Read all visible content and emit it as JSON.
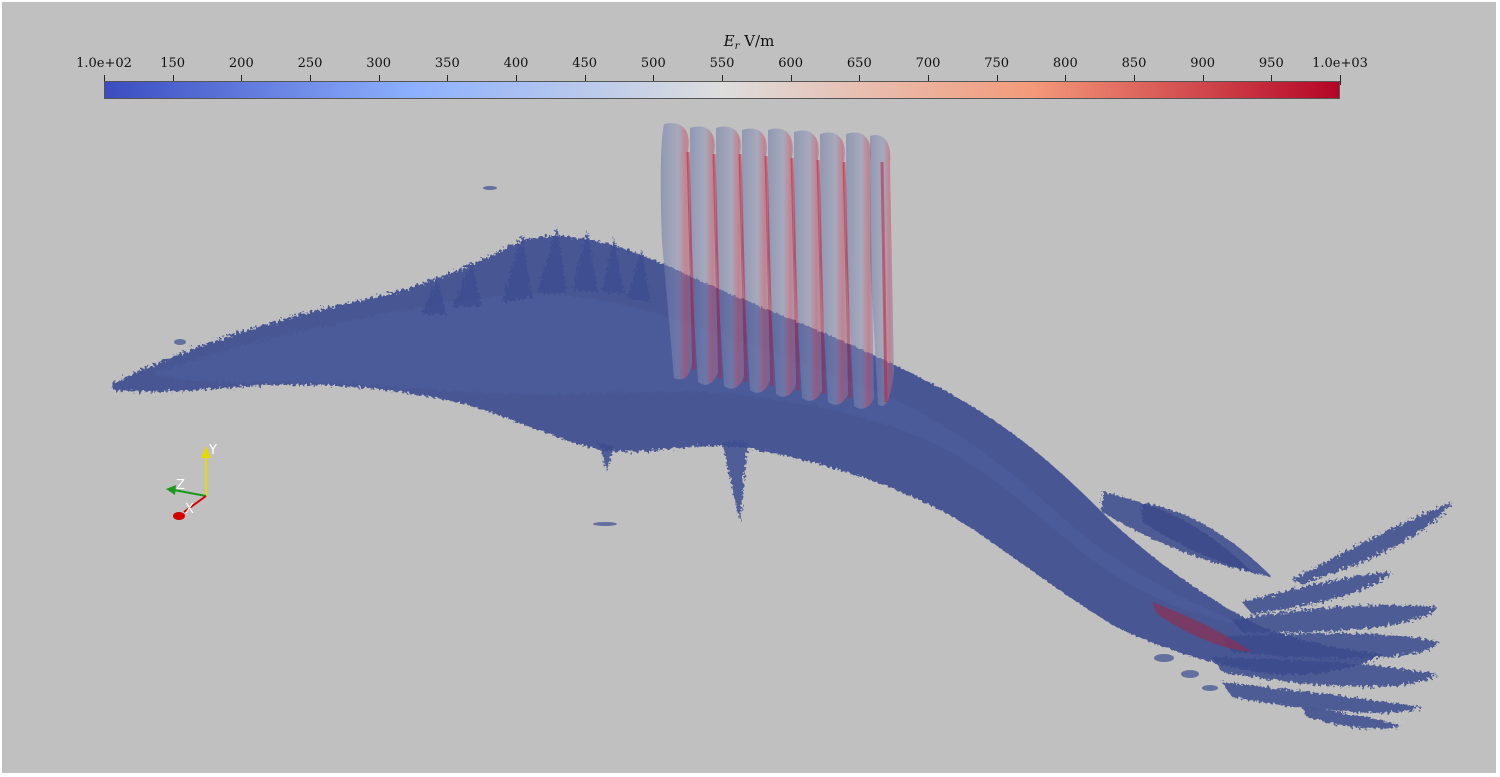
{
  "colorbar": {
    "symbol": "E",
    "subscript": "r",
    "unit": "V/m",
    "tick_labels": [
      "1.0e+02",
      "150",
      "200",
      "250",
      "300",
      "350",
      "400",
      "450",
      "500",
      "550",
      "600",
      "650",
      "700",
      "750",
      "800",
      "850",
      "900",
      "950",
      "1.0e+03"
    ],
    "range": [
      100,
      1000
    ],
    "colormap": [
      "#3b4cc0",
      "#8db0fe",
      "#dddddd",
      "#f49a7b",
      "#b40426"
    ]
  },
  "orientation_axes": {
    "x_label": "X",
    "y_label": "Y",
    "z_label": "Z",
    "x_color": "#d40000",
    "y_color": "#e6d800",
    "z_color": "#1a9a1a"
  },
  "colors": {
    "background": "#c0c0c0",
    "low_field": "#3b4a8c",
    "high_field": "#b40426"
  }
}
